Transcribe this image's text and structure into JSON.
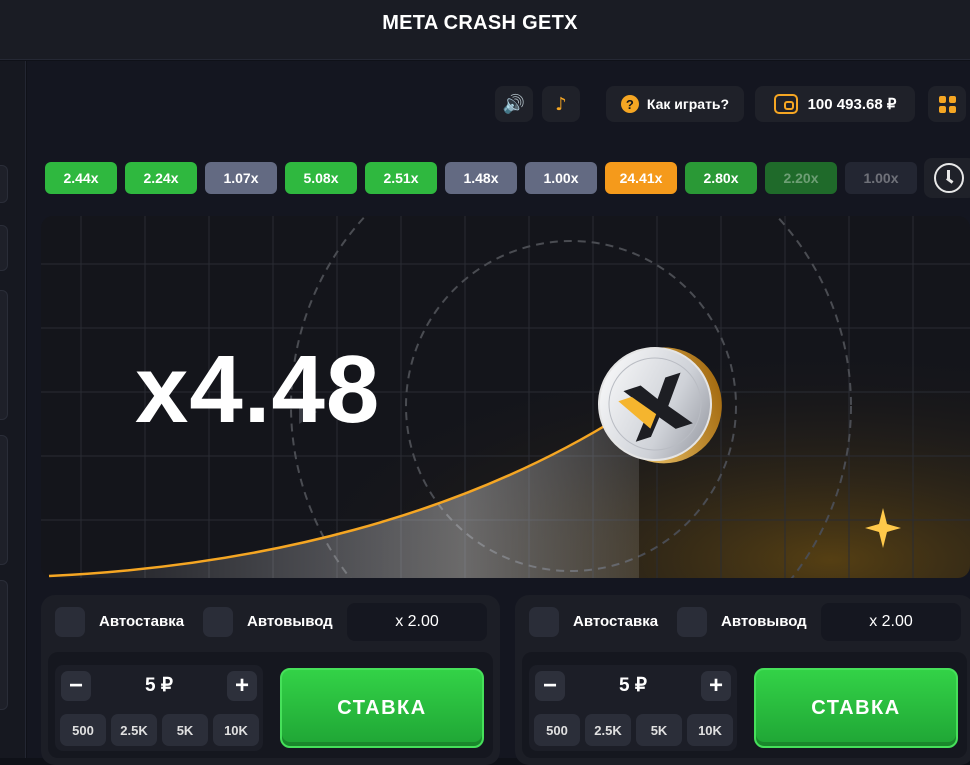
{
  "app": {
    "title": "META CRASH GETX"
  },
  "controls": {
    "sound_icon": "speaker-icon",
    "music_icon": "music-note-icon",
    "help_label": "Как играть?",
    "balance": "100 493.68 ₽",
    "menu_icon": "grid-menu-icon"
  },
  "history": [
    {
      "value": "2.44x",
      "color": "#2fb83f"
    },
    {
      "value": "2.24x",
      "color": "#2fb83f"
    },
    {
      "value": "1.07x",
      "color": "#636a82"
    },
    {
      "value": "5.08x",
      "color": "#2fb83f"
    },
    {
      "value": "2.51x",
      "color": "#2fb83f"
    },
    {
      "value": "1.48x",
      "color": "#636a82"
    },
    {
      "value": "1.00x",
      "color": "#636a82"
    },
    {
      "value": "24.41x",
      "color": "#f59a1b"
    },
    {
      "value": "2.80x",
      "color": "#2a9936"
    },
    {
      "value": "2.20x",
      "color": "#1f6a2a"
    },
    {
      "value": "1.00x",
      "color": "#232632"
    }
  ],
  "game": {
    "multiplier": "x4.48"
  },
  "bet_panels": [
    {
      "autobet_label": "Автоставка",
      "autocashout_label": "Автовывод",
      "autocashout_value": "x 2.00",
      "amount": "5 ₽",
      "quick": [
        "500",
        "2.5K",
        "5K",
        "10K"
      ],
      "bet_label": "СТАВКА"
    },
    {
      "autobet_label": "Автоставка",
      "autocashout_label": "Автовывод",
      "autocashout_value": "x 2.00",
      "amount": "5 ₽",
      "quick": [
        "500",
        "2.5K",
        "5K",
        "10K"
      ],
      "bet_label": "СТАВКА"
    }
  ]
}
